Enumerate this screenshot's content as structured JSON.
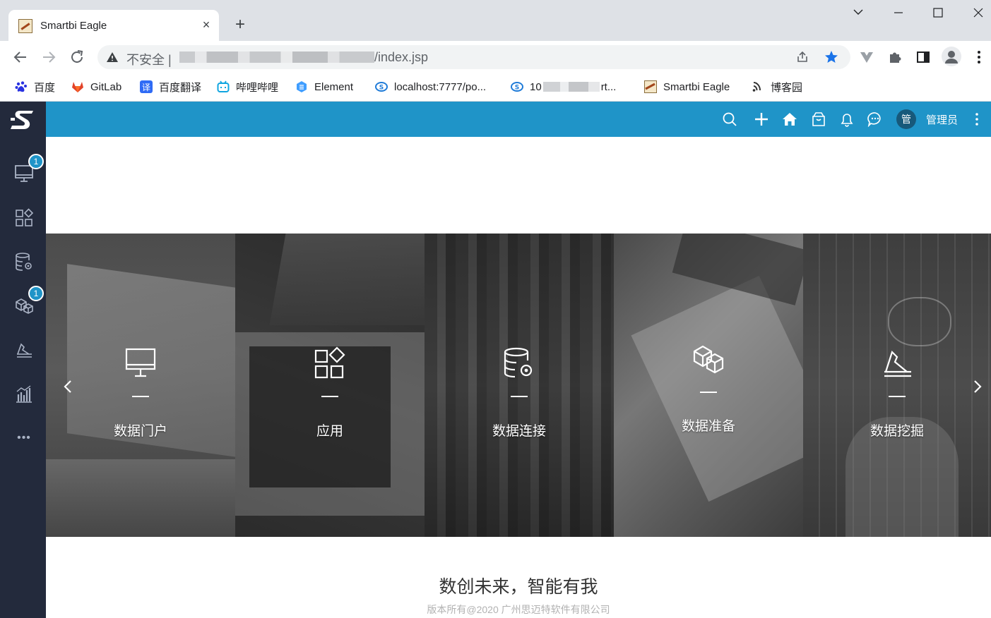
{
  "browser": {
    "tab": {
      "title": "Smartbi Eagle",
      "close_icon": "×"
    },
    "new_tab_icon": "+",
    "omnibox": {
      "security_label": "不安全 |",
      "url_suffix": "/index.jsp"
    },
    "bookmarks": [
      {
        "label": "百度",
        "icon": "baidu-icon",
        "color": "#2932e1"
      },
      {
        "label": "GitLab",
        "icon": "gitlab-icon",
        "color": "#e24329"
      },
      {
        "label": "百度翻译",
        "icon": "translate-icon",
        "color": "#2f6bf5"
      },
      {
        "label": "哔哩哔哩",
        "icon": "bilibili-icon",
        "color": "#0fa5e0"
      },
      {
        "label": "Element",
        "icon": "element-icon",
        "color": "#409eff"
      },
      {
        "label": "localhost:7777/po...",
        "icon": "smartbi-icon",
        "color": "#1f7bd8"
      },
      {
        "label_prefix": "10",
        "label_suffix": "rt...",
        "icon": "smartbi-icon",
        "color": "#1f7bd8"
      },
      {
        "label": "Smartbi Eagle",
        "icon": "eagle-icon",
        "color": "#a3471c"
      },
      {
        "label": "博客园",
        "icon": "cnblogs-icon",
        "color": "#333333"
      }
    ]
  },
  "app": {
    "brand_color": "#1f94c8",
    "sidebar_color": "#232a3c",
    "topbar": {
      "icons": [
        "search-icon",
        "plus-icon",
        "home-icon",
        "bag-icon",
        "bell-icon",
        "chat-icon",
        "more-icon"
      ],
      "user_avatar": "管",
      "user_name": "管理员"
    },
    "sidebar": {
      "items": [
        {
          "icon": "monitor-icon",
          "badge": "1"
        },
        {
          "icon": "apps-icon"
        },
        {
          "icon": "database-gear-icon"
        },
        {
          "icon": "cubes-icon",
          "badge": "1"
        },
        {
          "icon": "mining-icon"
        },
        {
          "icon": "bar-chart-icon"
        },
        {
          "icon": "more-horizontal-icon",
          "text": "•••"
        }
      ]
    },
    "carousel": {
      "panels": [
        {
          "label": "数据门户",
          "icon": "monitor-icon"
        },
        {
          "label": "应用",
          "icon": "apps-icon"
        },
        {
          "label": "数据连接",
          "icon": "database-gear-icon"
        },
        {
          "label": "数据准备",
          "icon": "cubes-icon"
        },
        {
          "label": "数据挖掘",
          "icon": "mining-icon"
        }
      ],
      "prev_icon": "chevron-left-icon",
      "next_icon": "chevron-right-icon"
    },
    "footer": {
      "slogan": "数创未来，智能有我",
      "copyright": "版本所有@2020 广州思迈特软件有限公司"
    }
  }
}
